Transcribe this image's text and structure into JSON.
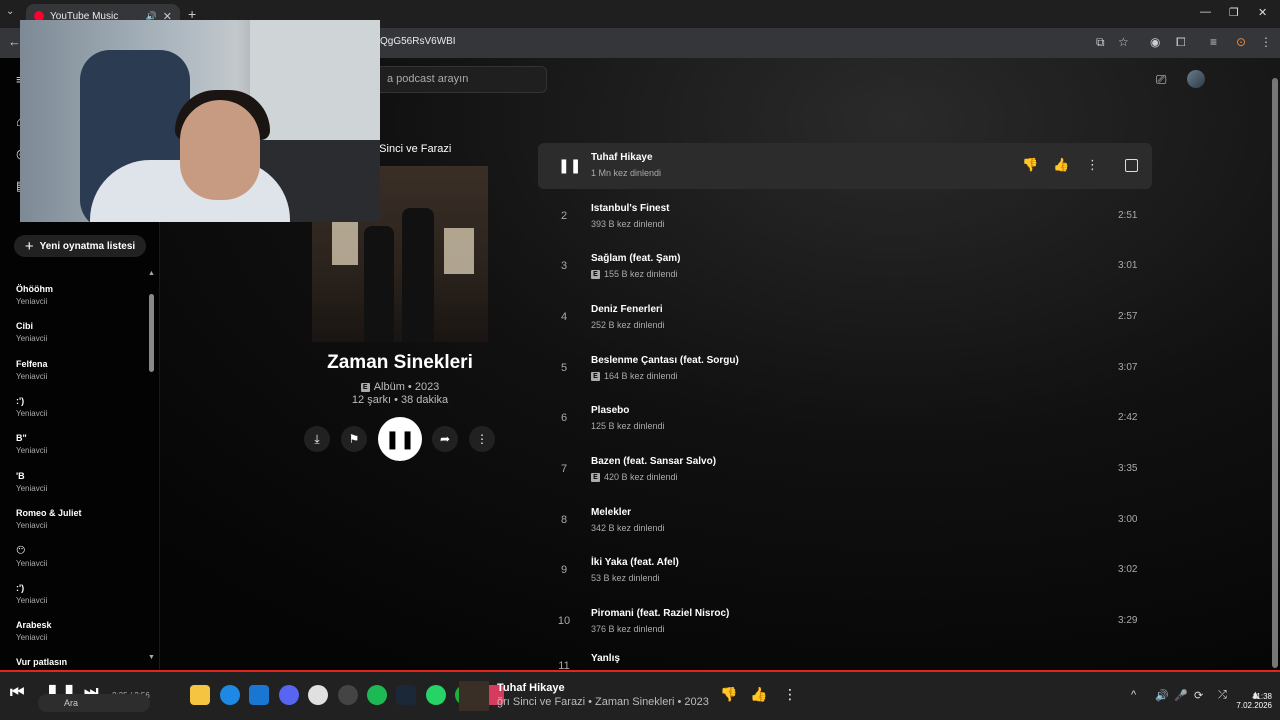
{
  "browser": {
    "tab_title": "YouTube Music",
    "url_fragment": "QgG56RsV6WBI"
  },
  "ytm": {
    "search_placeholder": "a podcast arayın",
    "new_playlist": "Yeni oynatma listesi",
    "playlists": [
      {
        "title": "Öhööhm",
        "owner": "Yeniavcii"
      },
      {
        "title": "Cibi",
        "owner": "Yeniavcii"
      },
      {
        "title": "Felfena",
        "owner": "Yeniavcii"
      },
      {
        "title": ":')",
        "owner": "Yeniavcii"
      },
      {
        "title": "B\"",
        "owner": "Yeniavcii"
      },
      {
        "title": "'B",
        "owner": "Yeniavcii"
      },
      {
        "title": "Romeo & Juliet",
        "owner": "Yeniavcii"
      },
      {
        "title": "😶",
        "owner": "Yeniavcii"
      },
      {
        "title": ":')",
        "owner": "Yeniavcii"
      },
      {
        "title": "Arabesk",
        "owner": "Yeniavcii"
      },
      {
        "title": "Vur patlasın",
        "owner": ""
      }
    ],
    "album": {
      "artists_line": "n Sinci ve Farazi",
      "title": "Zaman Sinekleri",
      "type_year": "Albüm • 2023",
      "counts": "12 şarkı • 38 dakika"
    },
    "tracks": [
      {
        "num": "1",
        "title": "Tuhaf Hikaye",
        "plays": "1 Mn kez dinlendi",
        "duration": "",
        "explicit": false,
        "active": true
      },
      {
        "num": "2",
        "title": "Istanbul's Finest",
        "plays": "393 B kez dinlendi",
        "duration": "2:51",
        "explicit": false
      },
      {
        "num": "3",
        "title": "Sağlam (feat. Şam)",
        "plays": "155 B kez dinlendi",
        "duration": "3:01",
        "explicit": true
      },
      {
        "num": "4",
        "title": "Deniz Fenerleri",
        "plays": "252 B kez dinlendi",
        "duration": "2:57",
        "explicit": false
      },
      {
        "num": "5",
        "title": "Beslenme Çantası (feat. Sorgu)",
        "plays": "164 B kez dinlendi",
        "duration": "3:07",
        "explicit": true
      },
      {
        "num": "6",
        "title": "Plasebo",
        "plays": "125 B kez dinlendi",
        "duration": "2:42",
        "explicit": false
      },
      {
        "num": "7",
        "title": "Bazen (feat. Sansar Salvo)",
        "plays": "420 B kez dinlendi",
        "duration": "3:35",
        "explicit": true
      },
      {
        "num": "8",
        "title": "Melekler",
        "plays": "342 B kez dinlendi",
        "duration": "3:00",
        "explicit": false
      },
      {
        "num": "9",
        "title": "İki Yaka (feat. Afel)",
        "plays": "53 B kez dinlendi",
        "duration": "3:02",
        "explicit": false
      },
      {
        "num": "10",
        "title": "Piromani (feat. Raziel Nisroc)",
        "plays": "376 B kez dinlendi",
        "duration": "3:29",
        "explicit": false
      },
      {
        "num": "11",
        "title": "Yanlış",
        "plays": "",
        "duration": "",
        "explicit": false
      }
    ]
  },
  "player": {
    "time": "2:35 / 2:56",
    "now_title": "Tuhaf Hikaye",
    "now_sub": "ğrı Sinci ve Farazi • Zaman Sinekleri • 2023"
  },
  "taskbar": {
    "search_label": "Ara",
    "clock_date": "7.02.2026",
    "clock_time": "11:38"
  },
  "colors": {
    "accent": "#e3241b",
    "bg": "#030303"
  }
}
